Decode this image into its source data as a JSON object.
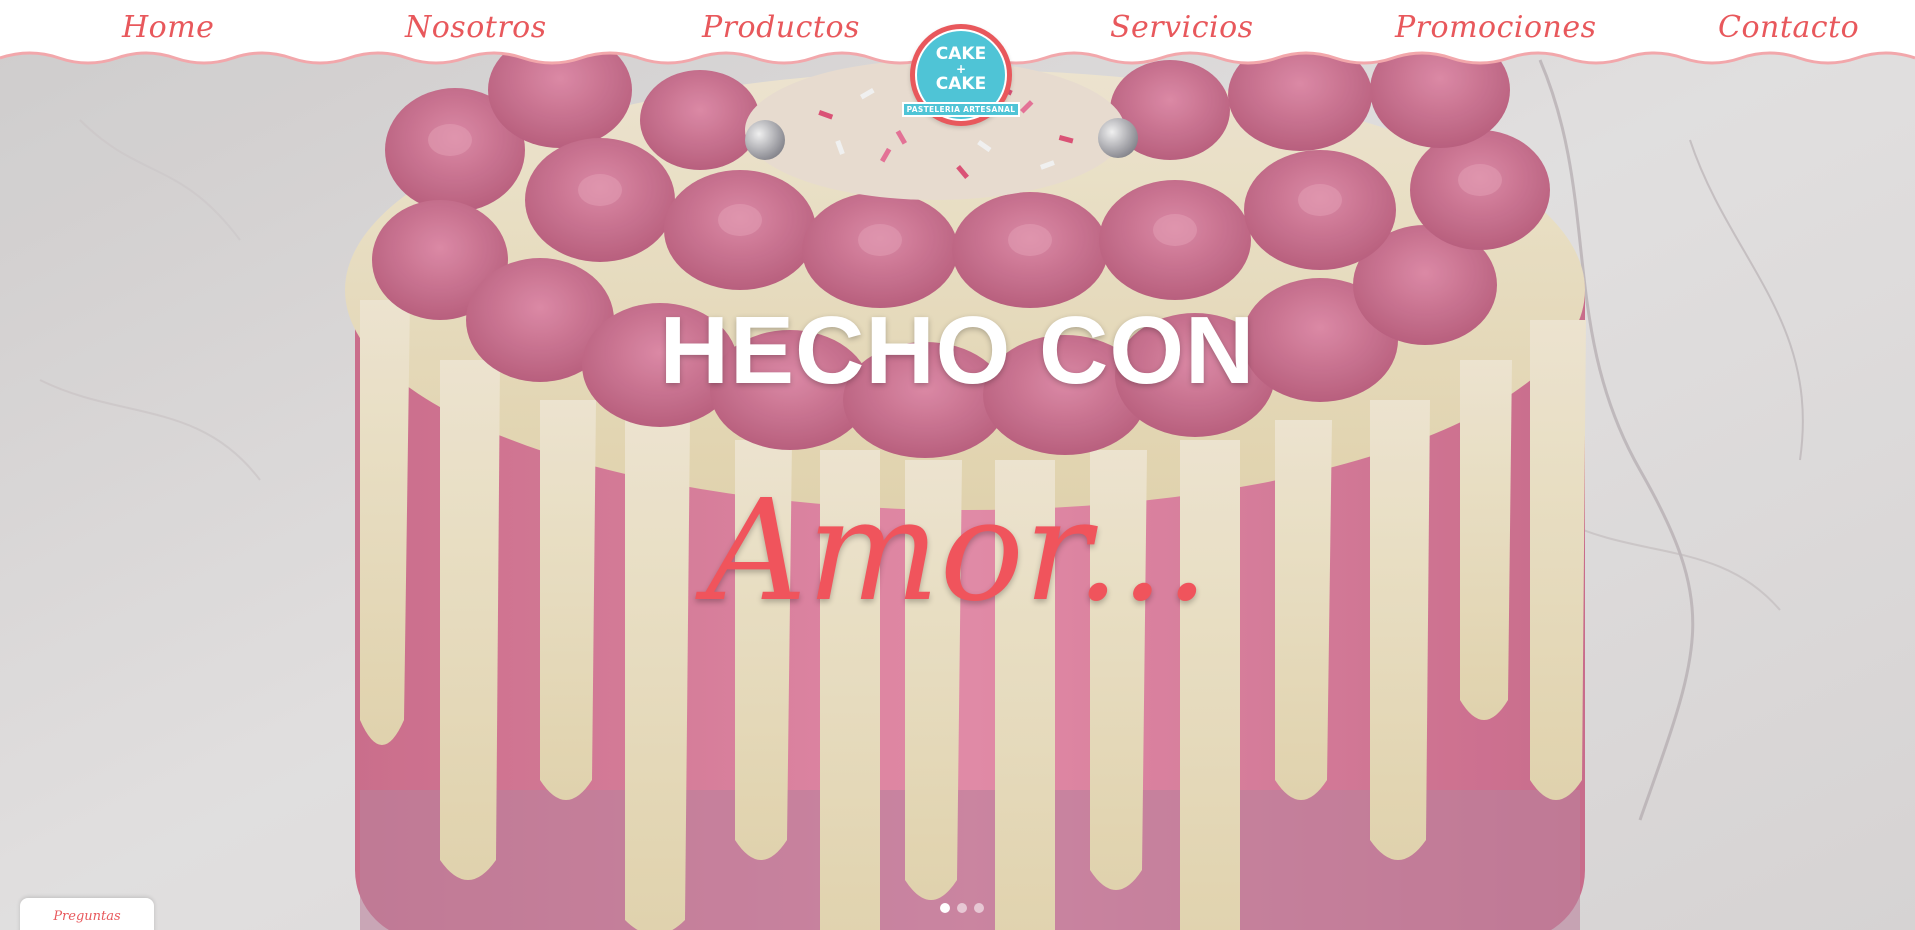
{
  "nav": {
    "items": [
      {
        "label": "Home"
      },
      {
        "label": "Nosotros"
      },
      {
        "label": "Productos"
      },
      {
        "label": "Servicios"
      },
      {
        "label": "Promociones"
      },
      {
        "label": "Contacto"
      }
    ]
  },
  "logo": {
    "line1": "CAKE",
    "plus": "+",
    "line2": "CAKE",
    "tagline": "PASTELERIA ARTESANAL"
  },
  "hero": {
    "headline": "HECHO CON",
    "script_word": "Amor..."
  },
  "slider": {
    "dot_count": 3,
    "active_index": 0
  },
  "faq": {
    "label": "Preguntas Frecuentes"
  },
  "colors": {
    "brand_coral": "#e8585c",
    "logo_teal": "#4fc4d6",
    "cake_pink": "#e88aa8",
    "drip_cream": "#f3e6c3",
    "marble": "#e9e6e6"
  }
}
